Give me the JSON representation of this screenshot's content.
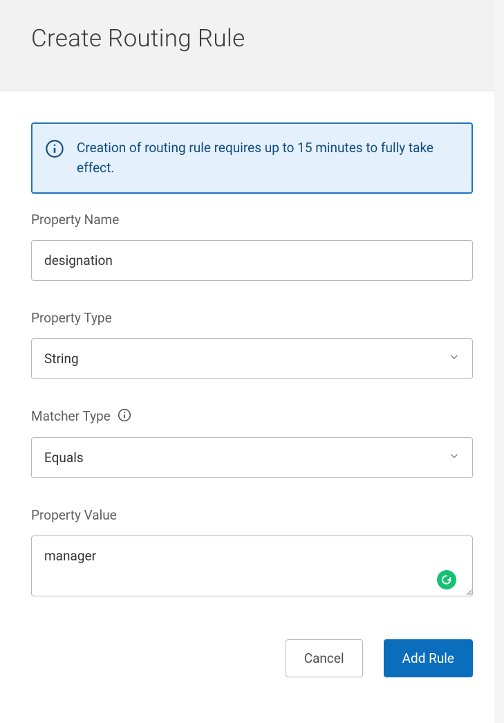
{
  "header": {
    "title": "Create Routing Rule"
  },
  "info": {
    "message": "Creation of routing rule requires up to 15 minutes to fully take effect."
  },
  "fields": {
    "propertyName": {
      "label": "Property Name",
      "value": "designation"
    },
    "propertyType": {
      "label": "Property Type",
      "value": "String"
    },
    "matcherType": {
      "label": "Matcher Type",
      "value": "Equals"
    },
    "propertyValue": {
      "label": "Property Value",
      "value": "manager"
    }
  },
  "buttons": {
    "cancel": "Cancel",
    "addRule": "Add Rule"
  }
}
